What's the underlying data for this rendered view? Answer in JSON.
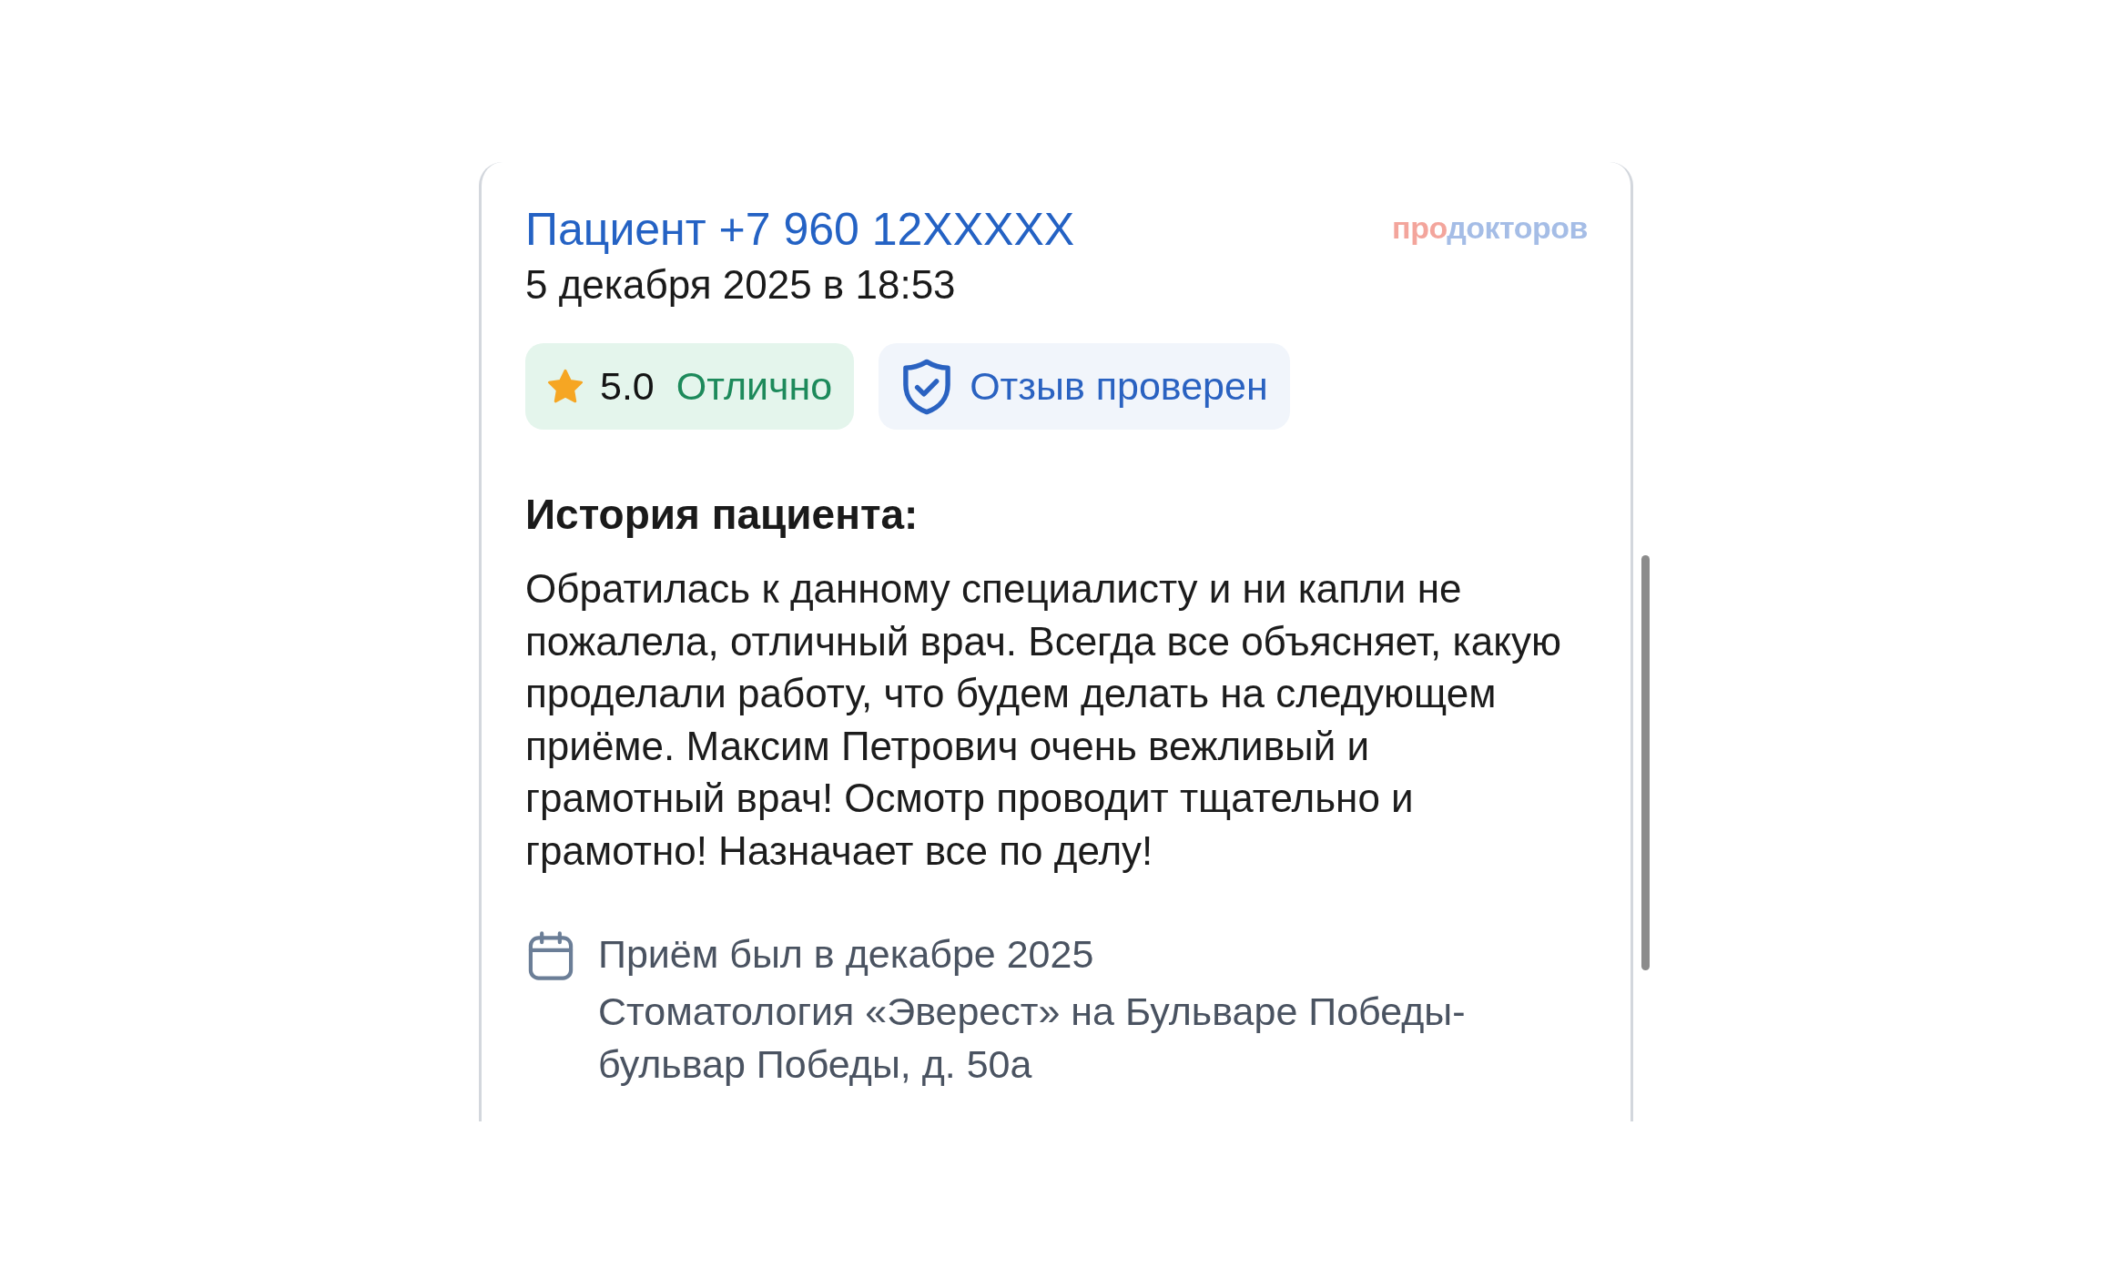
{
  "review": {
    "author": "Пациент +7 960 12XXXXX",
    "date": "5 декабря 2025 в 18:53",
    "brand_logo": {
      "accent": "про",
      "main": "докторов"
    },
    "rating": {
      "score": "5.0",
      "label": "Отлично"
    },
    "verification": {
      "label": "Отзыв проверен"
    },
    "story": {
      "heading": "История пациента:",
      "text": "Обратилась к данному специалисту и ни капли не\nпожалела, отличный врач. Всегда все объясняет, какую\nпроделали работу, что будем делать на следующем\nприёме. Максим Петрович очень вежливый и\nграмотный врач! Осмотр проводит тщательно и\nграмотно! Назначает все по делу!"
    },
    "visit": {
      "date": "Приём был в декабре 2025",
      "clinic": "Стоматология «Эверест» на Бульваре Победы-\nбульвар Победы, д. 50а"
    }
  }
}
